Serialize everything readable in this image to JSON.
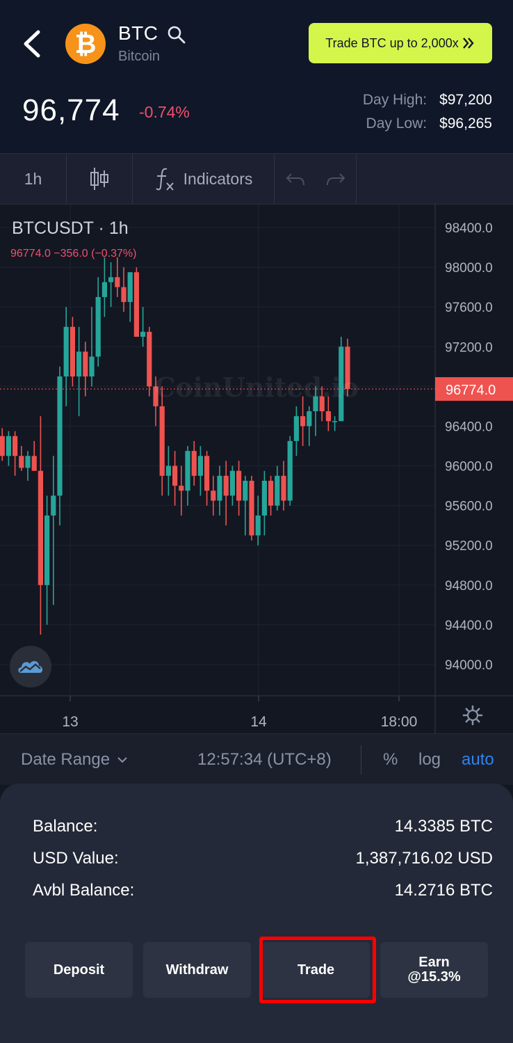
{
  "header": {
    "coin_symbol": "BTC",
    "coin_name": "Bitcoin",
    "coin_logo_glyph": "₿",
    "promo_label": "Trade BTC up to 2,000x",
    "price": "96,774",
    "change": "-0.74%",
    "day_high_label": "Day High:",
    "day_high_value": "$97,200",
    "day_low_label": "Day Low:",
    "day_low_value": "$96,265"
  },
  "toolbar": {
    "interval": "1h",
    "indicators_label": "Indicators",
    "candle_icon": "candlestick-icon",
    "fx_icon": "function-icon"
  },
  "chart": {
    "symbol_line": "BTCUSDT · 1h",
    "ohlc_line": "96774.0  −356.0 (−0.37%)",
    "watermark": "CoinUnited.io",
    "last_price_label": "96774.0"
  },
  "chart_data": {
    "type": "candlestick",
    "title": "BTCUSDT · 1h",
    "y_ticks": [
      "98400.0",
      "98000.0",
      "97600.0",
      "97200.0",
      "96800.0",
      "96400.0",
      "96000.0",
      "95600.0",
      "95200.0",
      "94800.0",
      "94400.0",
      "94000.0"
    ],
    "x_ticks": [
      "13",
      "14",
      "18:00"
    ],
    "ylim": [
      93700,
      98700
    ],
    "last_price": 96774.0,
    "up_color": "#26a69a",
    "down_color": "#ef5350",
    "candles": [
      {
        "o": 96050,
        "h": 96400,
        "l": 95900,
        "c": 96300
      },
      {
        "o": 96300,
        "h": 96380,
        "l": 96050,
        "c": 96100
      },
      {
        "o": 96100,
        "h": 96350,
        "l": 96000,
        "c": 96300
      },
      {
        "o": 96300,
        "h": 96350,
        "l": 95900,
        "c": 96100
      },
      {
        "o": 96100,
        "h": 96200,
        "l": 95950,
        "c": 95980
      },
      {
        "o": 95980,
        "h": 96150,
        "l": 95850,
        "c": 96100
      },
      {
        "o": 96100,
        "h": 96250,
        "l": 95950,
        "c": 95950
      },
      {
        "o": 95950,
        "h": 96500,
        "l": 94300,
        "c": 94800
      },
      {
        "o": 94800,
        "h": 95700,
        "l": 94400,
        "c": 95500
      },
      {
        "o": 95500,
        "h": 96100,
        "l": 94600,
        "c": 95700
      },
      {
        "o": 95700,
        "h": 97000,
        "l": 95400,
        "c": 96900
      },
      {
        "o": 96900,
        "h": 97600,
        "l": 96600,
        "c": 97400
      },
      {
        "o": 97400,
        "h": 97500,
        "l": 96800,
        "c": 96900
      },
      {
        "o": 96900,
        "h": 97400,
        "l": 96500,
        "c": 97150
      },
      {
        "o": 97150,
        "h": 97250,
        "l": 96700,
        "c": 96900
      },
      {
        "o": 96900,
        "h": 97600,
        "l": 96800,
        "c": 97100
      },
      {
        "o": 97100,
        "h": 97900,
        "l": 97000,
        "c": 97700
      },
      {
        "o": 97700,
        "h": 98100,
        "l": 97500,
        "c": 97850
      },
      {
        "o": 97850,
        "h": 98050,
        "l": 97600,
        "c": 97900
      },
      {
        "o": 97900,
        "h": 98100,
        "l": 97700,
        "c": 97800
      },
      {
        "o": 97800,
        "h": 98000,
        "l": 97550,
        "c": 97650
      },
      {
        "o": 97650,
        "h": 97950,
        "l": 97450,
        "c": 97950
      },
      {
        "o": 97950,
        "h": 98000,
        "l": 97400,
        "c": 97300
      },
      {
        "o": 97300,
        "h": 97600,
        "l": 97200,
        "c": 97350
      },
      {
        "o": 97350,
        "h": 97400,
        "l": 96700,
        "c": 96800
      },
      {
        "o": 96800,
        "h": 96900,
        "l": 96400,
        "c": 96600
      },
      {
        "o": 96600,
        "h": 96800,
        "l": 95700,
        "c": 95900
      },
      {
        "o": 95900,
        "h": 96200,
        "l": 95700,
        "c": 96000
      },
      {
        "o": 96000,
        "h": 96150,
        "l": 95600,
        "c": 95800
      },
      {
        "o": 95800,
        "h": 96000,
        "l": 95500,
        "c": 95750
      },
      {
        "o": 95750,
        "h": 96200,
        "l": 95600,
        "c": 96150
      },
      {
        "o": 96150,
        "h": 96250,
        "l": 95800,
        "c": 95900
      },
      {
        "o": 95900,
        "h": 96200,
        "l": 95700,
        "c": 96100
      },
      {
        "o": 96100,
        "h": 96150,
        "l": 95600,
        "c": 95750
      },
      {
        "o": 95750,
        "h": 95900,
        "l": 95500,
        "c": 95650
      },
      {
        "o": 95650,
        "h": 96000,
        "l": 95500,
        "c": 95900
      },
      {
        "o": 95900,
        "h": 96050,
        "l": 95400,
        "c": 95700
      },
      {
        "o": 95700,
        "h": 96000,
        "l": 95600,
        "c": 95950
      },
      {
        "o": 95950,
        "h": 96050,
        "l": 95500,
        "c": 95650
      },
      {
        "o": 95650,
        "h": 95900,
        "l": 95300,
        "c": 95850
      },
      {
        "o": 95850,
        "h": 95900,
        "l": 95250,
        "c": 95300
      },
      {
        "o": 95300,
        "h": 95700,
        "l": 95200,
        "c": 95500
      },
      {
        "o": 95500,
        "h": 95950,
        "l": 95300,
        "c": 95850
      },
      {
        "o": 95850,
        "h": 95900,
        "l": 95500,
        "c": 95600
      },
      {
        "o": 95600,
        "h": 96000,
        "l": 95550,
        "c": 95900
      },
      {
        "o": 95900,
        "h": 96050,
        "l": 95550,
        "c": 95650
      },
      {
        "o": 95650,
        "h": 96300,
        "l": 95600,
        "c": 96250
      },
      {
        "o": 96250,
        "h": 96600,
        "l": 96100,
        "c": 96500
      },
      {
        "o": 96500,
        "h": 96700,
        "l": 96200,
        "c": 96400
      },
      {
        "o": 96400,
        "h": 96600,
        "l": 96200,
        "c": 96550
      },
      {
        "o": 96550,
        "h": 96800,
        "l": 96300,
        "c": 96700
      },
      {
        "o": 96700,
        "h": 96800,
        "l": 96450,
        "c": 96550
      },
      {
        "o": 96550,
        "h": 96700,
        "l": 96350,
        "c": 96450
      },
      {
        "o": 96450,
        "h": 96500,
        "l": 96350,
        "c": 96450
      },
      {
        "o": 96450,
        "h": 97300,
        "l": 96450,
        "c": 97200
      },
      {
        "o": 97200,
        "h": 97280,
        "l": 96700,
        "c": 96774
      }
    ]
  },
  "range_bar": {
    "date_range_label": "Date Range",
    "time_label": "12:57:34 (UTC+8)",
    "percent_label": "%",
    "log_label": "log",
    "auto_label": "auto"
  },
  "panel": {
    "balance_label": "Balance:",
    "balance_value": "14.3385 BTC",
    "usd_label": "USD Value:",
    "usd_value": "1,387,716.02 USD",
    "avbl_label": "Avbl Balance:",
    "avbl_value": "14.2716 BTC",
    "deposit_label": "Deposit",
    "withdraw_label": "Withdraw",
    "trade_label": "Trade",
    "earn_label_1": "Earn",
    "earn_label_2": "@15.3%"
  }
}
